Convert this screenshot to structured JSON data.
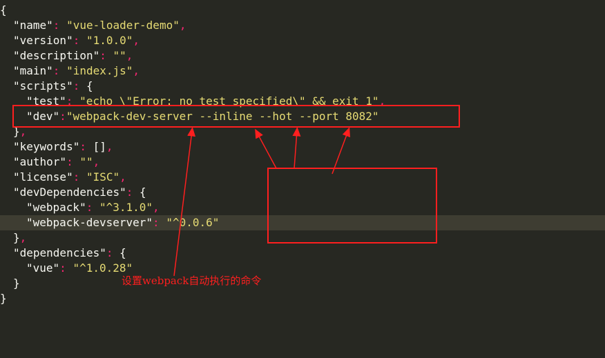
{
  "code": {
    "lines": [
      {
        "indent": 0,
        "parts": [
          {
            "t": "p",
            "v": "{"
          }
        ]
      },
      {
        "indent": 1,
        "parts": [
          {
            "t": "k",
            "v": "\"name\""
          },
          {
            "t": "c",
            "v": ":"
          },
          {
            "t": "p",
            "v": " "
          },
          {
            "t": "s",
            "v": "\"vue-loader-demo\""
          },
          {
            "t": "c",
            "v": ","
          }
        ]
      },
      {
        "indent": 1,
        "parts": [
          {
            "t": "k",
            "v": "\"version\""
          },
          {
            "t": "c",
            "v": ":"
          },
          {
            "t": "p",
            "v": " "
          },
          {
            "t": "s",
            "v": "\"1.0.0\""
          },
          {
            "t": "c",
            "v": ","
          }
        ]
      },
      {
        "indent": 1,
        "parts": [
          {
            "t": "k",
            "v": "\"description\""
          },
          {
            "t": "c",
            "v": ":"
          },
          {
            "t": "p",
            "v": " "
          },
          {
            "t": "s",
            "v": "\"\""
          },
          {
            "t": "c",
            "v": ","
          }
        ]
      },
      {
        "indent": 1,
        "parts": [
          {
            "t": "k",
            "v": "\"main\""
          },
          {
            "t": "c",
            "v": ":"
          },
          {
            "t": "p",
            "v": " "
          },
          {
            "t": "s",
            "v": "\"index.js\""
          },
          {
            "t": "c",
            "v": ","
          }
        ]
      },
      {
        "indent": 1,
        "parts": [
          {
            "t": "k",
            "v": "\"scripts\""
          },
          {
            "t": "c",
            "v": ":"
          },
          {
            "t": "p",
            "v": " {"
          }
        ]
      },
      {
        "indent": 2,
        "parts": [
          {
            "t": "k",
            "v": "\"test\""
          },
          {
            "t": "c",
            "v": ":"
          },
          {
            "t": "p",
            "v": " "
          },
          {
            "t": "s",
            "v": "\"echo \\\"Error: no test specified\\\" && exit 1\""
          },
          {
            "t": "c",
            "v": ","
          }
        ]
      },
      {
        "indent": 2,
        "parts": [
          {
            "t": "k",
            "v": "\"dev\""
          },
          {
            "t": "c",
            "v": ":"
          },
          {
            "t": "s",
            "v": "\"webpack-dev-server --inline --hot --port 8082\""
          }
        ]
      },
      {
        "indent": 1,
        "parts": [
          {
            "t": "p",
            "v": "}"
          },
          {
            "t": "c",
            "v": ","
          }
        ]
      },
      {
        "indent": 1,
        "parts": [
          {
            "t": "k",
            "v": "\"keywords\""
          },
          {
            "t": "c",
            "v": ":"
          },
          {
            "t": "p",
            "v": " []"
          },
          {
            "t": "c",
            "v": ","
          }
        ]
      },
      {
        "indent": 1,
        "parts": [
          {
            "t": "k",
            "v": "\"author\""
          },
          {
            "t": "c",
            "v": ":"
          },
          {
            "t": "p",
            "v": " "
          },
          {
            "t": "s",
            "v": "\"\""
          },
          {
            "t": "c",
            "v": ","
          }
        ]
      },
      {
        "indent": 1,
        "parts": [
          {
            "t": "k",
            "v": "\"license\""
          },
          {
            "t": "c",
            "v": ":"
          },
          {
            "t": "p",
            "v": " "
          },
          {
            "t": "s",
            "v": "\"ISC\""
          },
          {
            "t": "c",
            "v": ","
          }
        ]
      },
      {
        "indent": 1,
        "parts": [
          {
            "t": "k",
            "v": "\"devDependencies\""
          },
          {
            "t": "c",
            "v": ":"
          },
          {
            "t": "p",
            "v": " {"
          }
        ]
      },
      {
        "indent": 2,
        "parts": [
          {
            "t": "k",
            "v": "\"webpack\""
          },
          {
            "t": "c",
            "v": ":"
          },
          {
            "t": "p",
            "v": " "
          },
          {
            "t": "s",
            "v": "\"^3.1.0\""
          },
          {
            "t": "c",
            "v": ","
          }
        ]
      },
      {
        "indent": 2,
        "highlight": true,
        "parts": [
          {
            "t": "k",
            "v": "\"webpack-devserver\""
          },
          {
            "t": "c",
            "v": ":"
          },
          {
            "t": "p",
            "v": " "
          },
          {
            "t": "s",
            "v": "\"^0.0.6\""
          }
        ]
      },
      {
        "indent": 1,
        "parts": [
          {
            "t": "p",
            "v": "}"
          },
          {
            "t": "c",
            "v": ","
          }
        ]
      },
      {
        "indent": 1,
        "parts": [
          {
            "t": "k",
            "v": "\"dependencies\""
          },
          {
            "t": "c",
            "v": ":"
          },
          {
            "t": "p",
            "v": " {"
          }
        ]
      },
      {
        "indent": 2,
        "parts": [
          {
            "t": "k",
            "v": "\"vue\""
          },
          {
            "t": "c",
            "v": ":"
          },
          {
            "t": "p",
            "v": " "
          },
          {
            "t": "s",
            "v": "\"^1.0.28\""
          }
        ]
      },
      {
        "indent": 1,
        "parts": [
          {
            "t": "p",
            "v": "}"
          }
        ]
      },
      {
        "indent": 0,
        "parts": [
          {
            "t": "p",
            "v": "}"
          }
        ]
      }
    ]
  },
  "annotation": {
    "text": "设置webpack自动执行的命令",
    "color": "#ff1f1f"
  },
  "colors": {
    "background": "#272822",
    "key": "#f8f8f2",
    "string": "#e6db74",
    "colon": "#f92672",
    "highlight": "#3e3d32"
  }
}
